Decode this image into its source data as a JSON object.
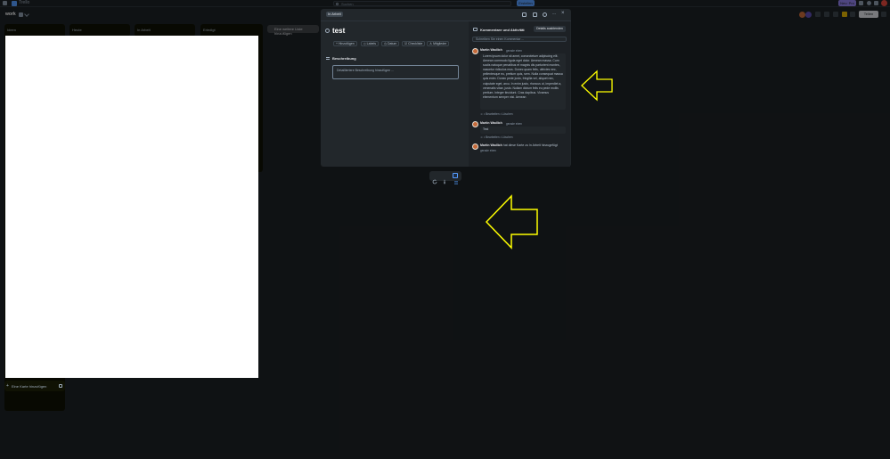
{
  "topbar": {
    "brand": "Trello",
    "search_placeholder": "Suchen",
    "create_label": "Erstellen",
    "upgrade_label": "Neu: Pro"
  },
  "board": {
    "title": "work",
    "share_label": "Teilen",
    "lists": [
      {
        "title": "Ideen"
      },
      {
        "title": "Heute"
      },
      {
        "title": "In Arbeit"
      },
      {
        "title": "Erledigt"
      }
    ],
    "add_list_label": "Eine weitere Liste hinzufügen",
    "add_card_label": "Eine Karte hinzufügen"
  },
  "modal": {
    "list_badge": "In Arbeit",
    "card_title": "test",
    "actions": [
      "Hinzufügen",
      "Labels",
      "Datum",
      "Checkliste",
      "Mitglieder"
    ],
    "description_label": "Beschreibung",
    "description_placeholder": "Detailliertere Beschreibung hinzufügen ..."
  },
  "activity": {
    "heading": "Kommentare und Aktivität",
    "details_button": "Details ausblenden",
    "comment_placeholder": "Schreiben Sie einen Kommentar ...",
    "items": [
      {
        "author": "Martin Wadlich",
        "time": "gerade eben",
        "text": "Lorem ipsum dolor sit amet, consectetuer adipiscing elit. Aenean commodo ligula eget dolor. Aenean massa. Cum sociis natoque penatibus et magnis dis parturient montes, nascetur ridiculus mus. Donec quam felis, ultricies nec, pellentesque eu, pretium quis, sem. Nulla consequat massa quis enim. Donec pede justo, fringilla vel, aliquet nec, vulputate eget, arcu. In enim justo, rhoncus ut, imperdiet a, venenatis vitae, justo. Nullam dictum felis eu pede mollis pretium. Integer tincidunt. Cras dapibus. Vivamus elementum semper nisi. Aenean",
        "meta": "Bearbeiten • Löschen"
      },
      {
        "author": "Martin Wadlich",
        "time": "gerade eben",
        "text": "Test",
        "meta": "Bearbeiten • Löschen"
      },
      {
        "author": "Martin Wadlich",
        "action": "hat diese Karte zu In Arbeit hinzugefügt",
        "time": "gerade eben"
      }
    ]
  },
  "colors": {
    "background": "#1d2125",
    "accent": "#579dff",
    "annotation_arrow": "#ffff00"
  },
  "icons": [
    "search-icon",
    "bell-icon",
    "info-icon",
    "watch-icon",
    "more-icon",
    "close-icon",
    "description-icon",
    "comment-icon",
    "refresh-icon",
    "pin-icon",
    "panel-icon"
  ]
}
